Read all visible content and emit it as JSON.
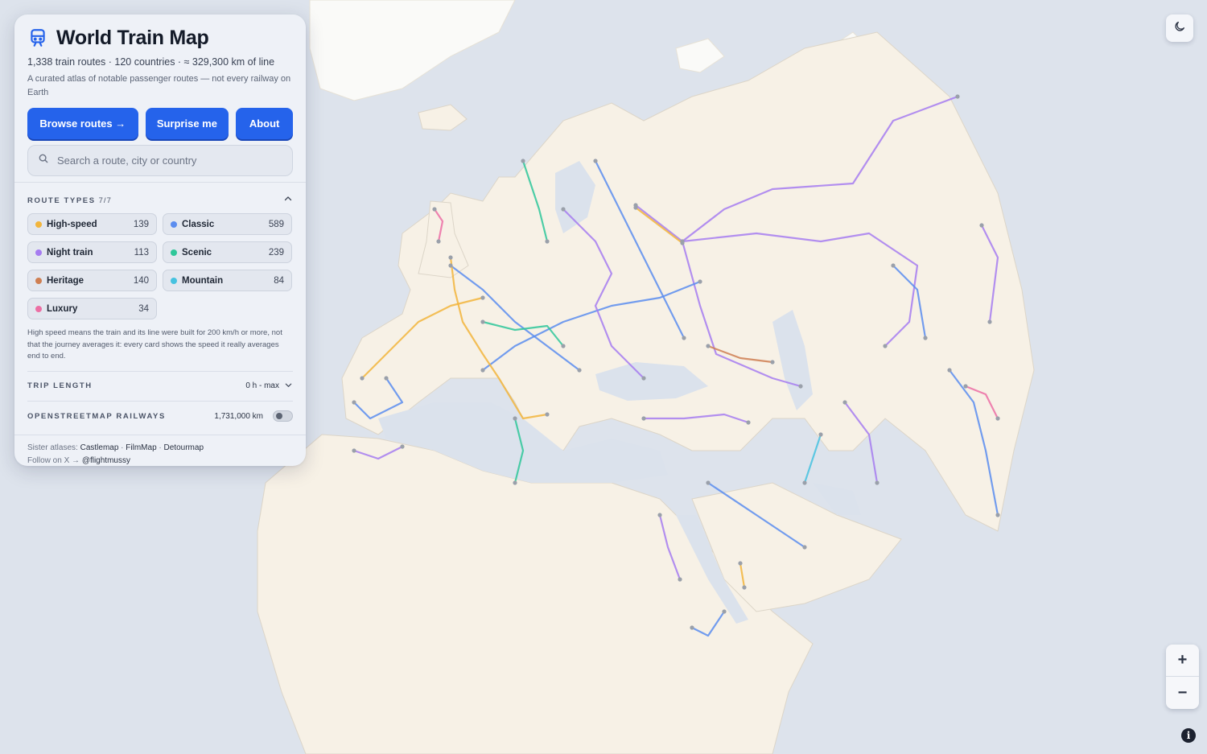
{
  "app": {
    "title": "World Train Map",
    "stats": "1,338 train routes · 120 countries · ≈ 329,300 km of line",
    "description": "A curated atlas of notable passenger routes — not every railway on Earth"
  },
  "buttons": {
    "browse": "Browse routes →",
    "surprise": "Surprise me",
    "about": "About"
  },
  "search": {
    "placeholder": "Search a route, city or country",
    "value": ""
  },
  "route_types": {
    "heading": "ROUTE TYPES",
    "count": "7/7",
    "items": [
      {
        "label": "High-speed",
        "count": "139",
        "color": "#f2b53c"
      },
      {
        "label": "Classic",
        "count": "589",
        "color": "#5b8def"
      },
      {
        "label": "Night train",
        "count": "113",
        "color": "#a67cf0"
      },
      {
        "label": "Scenic",
        "count": "239",
        "color": "#2fc79a"
      },
      {
        "label": "Heritage",
        "count": "140",
        "color": "#cf7f52"
      },
      {
        "label": "Mountain",
        "count": "84",
        "color": "#46c2e0"
      },
      {
        "label": "Luxury",
        "count": "34",
        "color": "#ec6fa4"
      }
    ],
    "note": "High speed means the train and its line were built for 200 km/h or more, not that the journey averages it: every card shows the speed it really averages end to end."
  },
  "trip_length": {
    "label": "TRIP LENGTH",
    "value": "0 h - max"
  },
  "osm": {
    "label": "OPENSTREETMAP RAILWAYS",
    "value": "1,731,000 km",
    "enabled": false
  },
  "footer": {
    "sister_prefix": "Sister atlases:",
    "sisters": [
      "Castlemap",
      "FilmMap",
      "Detourmap"
    ],
    "follow_prefix": "Follow on X →",
    "handle": "@flightmussy"
  },
  "controls": {
    "zoom_in": "+",
    "zoom_out": "−",
    "info": "i"
  },
  "map_colors": {
    "ocean": "#dbe2ec",
    "land": "#f7f1e6",
    "ice": "#fbfbfa",
    "border": "#d8d2c6"
  }
}
